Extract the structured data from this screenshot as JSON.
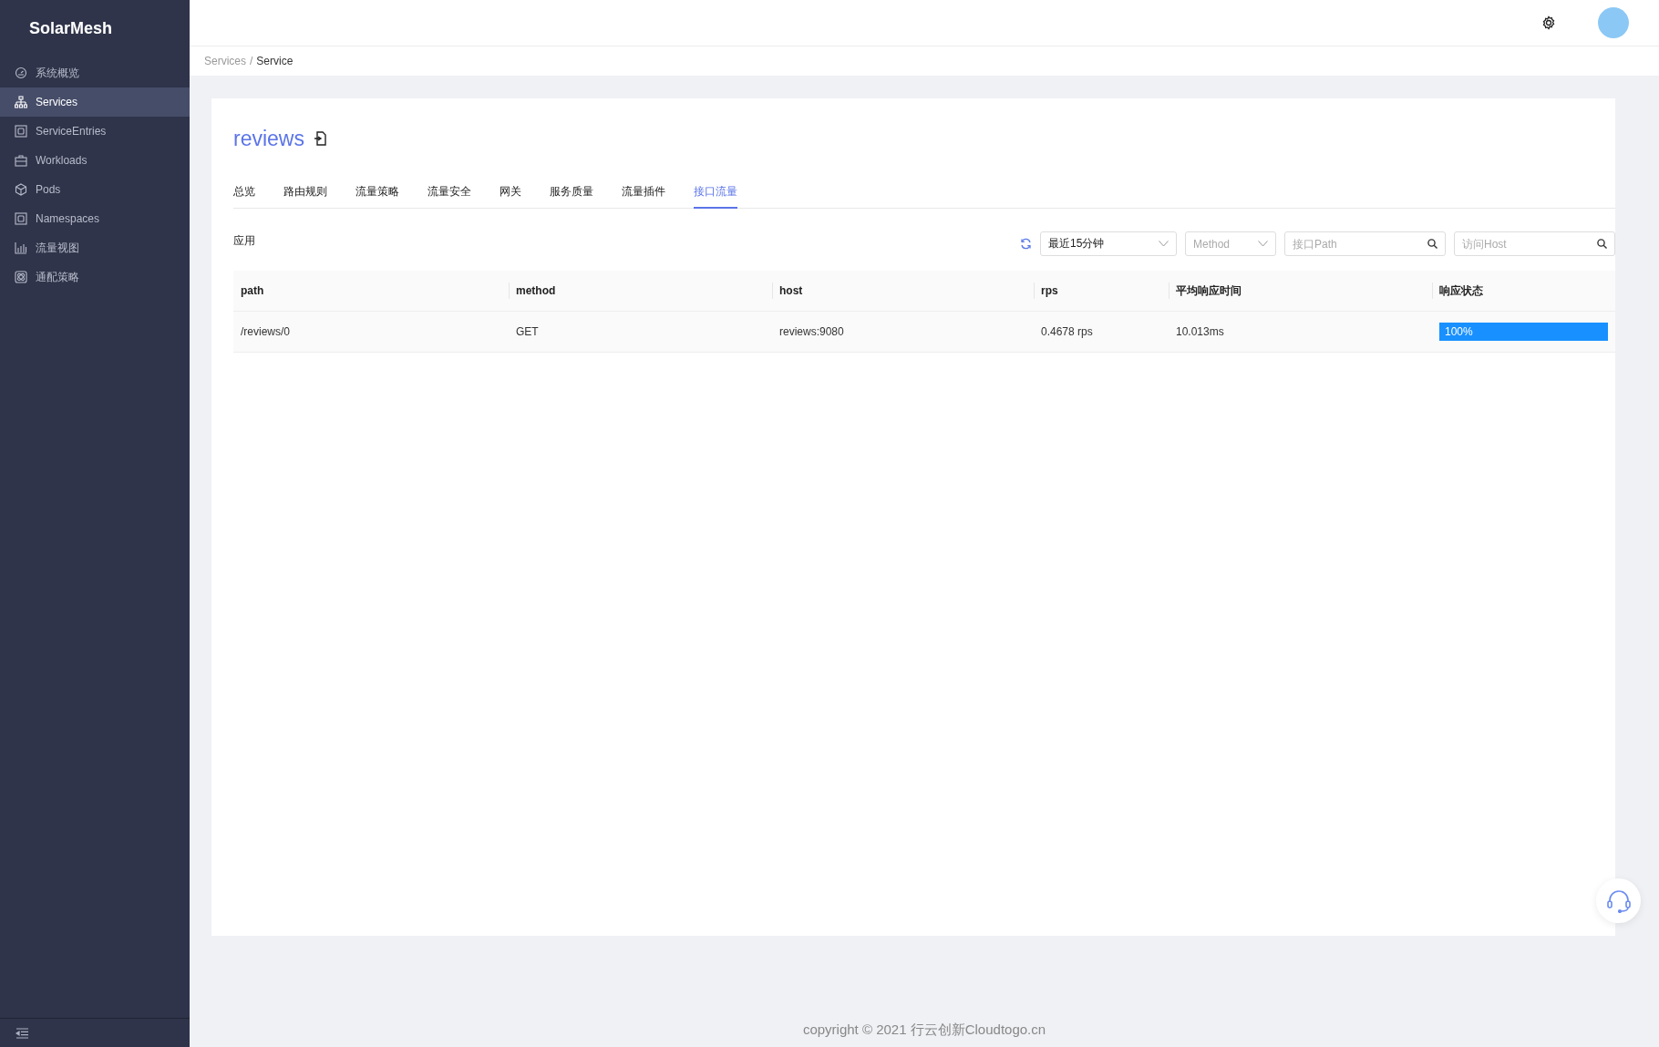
{
  "sidebar": {
    "brand": "SolarMesh",
    "items": [
      {
        "label": "系统概览",
        "kind": "gauge",
        "selected": false
      },
      {
        "label": "Services",
        "kind": "tree",
        "selected": true
      },
      {
        "label": "ServiceEntries",
        "kind": "frame",
        "selected": false
      },
      {
        "label": "Workloads",
        "kind": "case",
        "selected": false
      },
      {
        "label": "Pods",
        "kind": "cube",
        "selected": false
      },
      {
        "label": "Namespaces",
        "kind": "frame",
        "selected": false
      },
      {
        "label": "流量视图",
        "kind": "bars",
        "selected": false
      },
      {
        "label": "通配策略",
        "kind": "atom",
        "selected": false
      }
    ]
  },
  "breadcrumb": [
    {
      "label": "Services",
      "current": false
    },
    {
      "label": "Service",
      "current": true
    }
  ],
  "breadcrumb_separator": "/",
  "page": {
    "title": "reviews",
    "tabs": [
      {
        "label": "总览",
        "selected": false
      },
      {
        "label": "路由规则",
        "selected": false
      },
      {
        "label": "流量策略",
        "selected": false
      },
      {
        "label": "流量安全",
        "selected": false
      },
      {
        "label": "网关",
        "selected": false
      },
      {
        "label": "服务质量",
        "selected": false
      },
      {
        "label": "流量插件",
        "selected": false
      },
      {
        "label": "接口流量",
        "selected": true
      }
    ],
    "app_label": "应用",
    "filters": {
      "time": "最近15分钟",
      "method_placeholder": "Method",
      "path_placeholder": "接口Path",
      "host_placeholder": "访问Host"
    },
    "table": {
      "columns": [
        "path",
        "method",
        "host",
        "rps",
        "平均响应时间",
        "响应状态"
      ],
      "rows": [
        {
          "path": "/reviews/0",
          "method": "GET",
          "host": "reviews:9080",
          "rps": "0.4678 rps",
          "avg_time": "10.013ms",
          "status": {
            "label": "100%",
            "level": 1
          }
        }
      ]
    }
  },
  "footer": "copyright © 2021 行云创新Cloudtogo.cn"
}
